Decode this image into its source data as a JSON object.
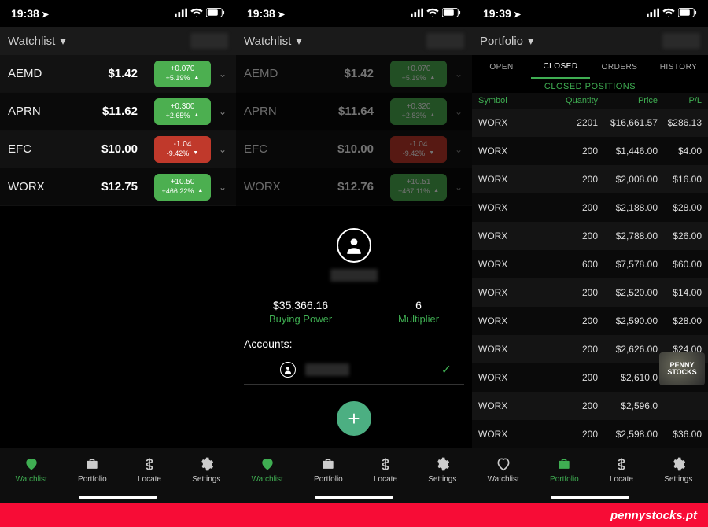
{
  "footer": "pennystocks.pt",
  "screens": [
    {
      "time": "19:38",
      "header": "Watchlist",
      "active_tab": "Watchlist",
      "has_fab": false,
      "watchlist": [
        {
          "sym": "AEMD",
          "price": "$1.42",
          "chg": "+0.070",
          "pct": "+5.19%",
          "dir": "up"
        },
        {
          "sym": "APRN",
          "price": "$11.62",
          "chg": "+0.300",
          "pct": "+2.65%",
          "dir": "up"
        },
        {
          "sym": "EFC",
          "price": "$10.00",
          "chg": "-1.04",
          "pct": "-9.42%",
          "dir": "down"
        },
        {
          "sym": "WORX",
          "price": "$12.75",
          "chg": "+10.50",
          "pct": "+466.22%",
          "dir": "up"
        }
      ]
    },
    {
      "time": "19:38",
      "header": "Watchlist",
      "active_tab": "Watchlist",
      "has_fab": true,
      "dim": true,
      "watchlist": [
        {
          "sym": "AEMD",
          "price": "$1.42",
          "chg": "+0.070",
          "pct": "+5.19%",
          "dir": "up"
        },
        {
          "sym": "APRN",
          "price": "$11.64",
          "chg": "+0.320",
          "pct": "+2.83%",
          "dir": "up"
        },
        {
          "sym": "EFC",
          "price": "$10.00",
          "chg": "-1.04",
          "pct": "-9.42%",
          "dir": "down"
        },
        {
          "sym": "WORX",
          "price": "$12.76",
          "chg": "+10.51",
          "pct": "+467.11%",
          "dir": "up"
        }
      ],
      "profile": {
        "buying_power": "$35,366.16",
        "bp_label": "Buying Power",
        "multiplier": "6",
        "mult_label": "Multiplier",
        "accounts_label": "Accounts:"
      }
    },
    {
      "time": "19:39",
      "header": "Portfolio",
      "active_tab": "Portfolio",
      "ptabs": [
        "OPEN",
        "CLOSED",
        "ORDERS",
        "HISTORY"
      ],
      "ptab_active": "CLOSED",
      "closed_title": "CLOSED POSITIONS",
      "cols": [
        "Symbol",
        "Quantity",
        "Price",
        "P/L"
      ],
      "rows": [
        {
          "s": "WORX",
          "q": "2201",
          "p": "$16,661.57",
          "pl": "$286.13"
        },
        {
          "s": "WORX",
          "q": "200",
          "p": "$1,446.00",
          "pl": "$4.00"
        },
        {
          "s": "WORX",
          "q": "200",
          "p": "$2,008.00",
          "pl": "$16.00"
        },
        {
          "s": "WORX",
          "q": "200",
          "p": "$2,188.00",
          "pl": "$28.00"
        },
        {
          "s": "WORX",
          "q": "200",
          "p": "$2,788.00",
          "pl": "$26.00"
        },
        {
          "s": "WORX",
          "q": "600",
          "p": "$7,578.00",
          "pl": "$60.00"
        },
        {
          "s": "WORX",
          "q": "200",
          "p": "$2,520.00",
          "pl": "$14.00"
        },
        {
          "s": "WORX",
          "q": "200",
          "p": "$2,590.00",
          "pl": "$28.00"
        },
        {
          "s": "WORX",
          "q": "200",
          "p": "$2,626.00",
          "pl": "$24.00"
        },
        {
          "s": "WORX",
          "q": "200",
          "p": "$2,610.0",
          "pl": ""
        },
        {
          "s": "WORX",
          "q": "200",
          "p": "$2,596.0",
          "pl": ""
        },
        {
          "s": "WORX",
          "q": "200",
          "p": "$2,598.00",
          "pl": "$36.00"
        }
      ],
      "badge": "PENNY STOCKS"
    }
  ],
  "tabs": [
    {
      "label": "Watchlist",
      "icon": "heart"
    },
    {
      "label": "Portfolio",
      "icon": "briefcase"
    },
    {
      "label": "Locate",
      "icon": "dollar"
    },
    {
      "label": "Settings",
      "icon": "gear"
    }
  ]
}
